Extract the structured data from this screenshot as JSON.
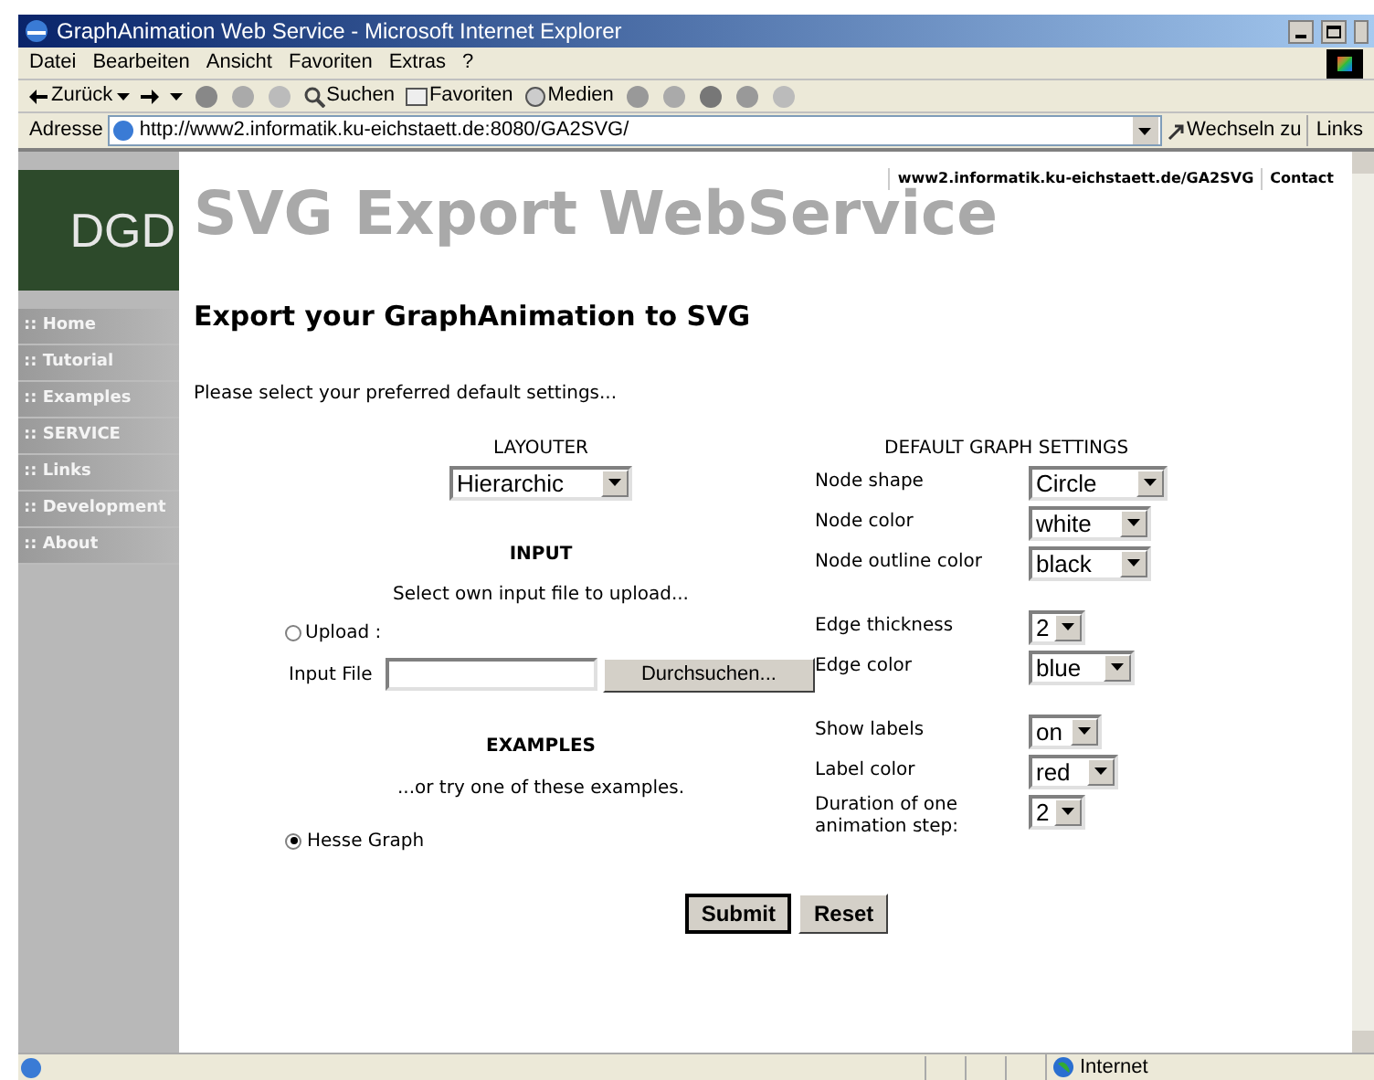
{
  "window": {
    "title": "GraphAnimation Web Service - Microsoft Internet Explorer"
  },
  "menu": [
    "Datei",
    "Bearbeiten",
    "Ansicht",
    "Favoriten",
    "Extras",
    "?"
  ],
  "toolbar": {
    "back": "Zurück",
    "search": "Suchen",
    "favorites": "Favoriten",
    "media": "Medien"
  },
  "address_bar": {
    "label": "Adresse",
    "url": "http://www2.informatik.ku-eichstaett.de:8080/GA2SVG/",
    "go": "Wechseln zu",
    "links": "Links"
  },
  "page": {
    "logo": "DGD",
    "title": "SVG Export WebService",
    "top_links": [
      "www2.informatik.ku-eichstaett.de/GA2SVG",
      "Contact"
    ],
    "nav": [
      ":: Home",
      ":: Tutorial",
      ":: Examples",
      ":: SERVICE",
      ":: Links",
      ":: Development",
      ":: About"
    ],
    "heading": "Export your GraphAnimation to SVG",
    "intro": "Please select your preferred default settings...",
    "layouter": {
      "heading": "LAYOUTER",
      "value": "Hierarchic"
    },
    "input": {
      "heading": "INPUT",
      "hint": "Select own input file to upload...",
      "radio": {
        "label": "Upload :",
        "selected": false
      },
      "file_label": "Input File",
      "browse": "Durchsuchen..."
    },
    "examples": {
      "heading": "EXAMPLES",
      "hint": "...or try one of these examples.",
      "radio": {
        "label": "Hesse Graph",
        "selected": true
      }
    },
    "settings": {
      "heading": "DEFAULT GRAPH SETTINGS",
      "groups": [
        [
          {
            "label": "Node shape",
            "value": "Circle"
          },
          {
            "label": "Node color",
            "value": "white"
          },
          {
            "label": "Node outline color",
            "value": "black"
          }
        ],
        [
          {
            "label": "Edge thickness",
            "value": "2"
          },
          {
            "label": "Edge color",
            "value": "blue"
          }
        ],
        [
          {
            "label": "Show labels",
            "value": "on"
          },
          {
            "label": "Label color",
            "value": "red"
          },
          {
            "label": "Duration of one animation step:",
            "value": "2"
          }
        ]
      ]
    },
    "buttons": [
      "Submit",
      "Reset"
    ]
  },
  "status_bar": {
    "zone": "Internet"
  }
}
